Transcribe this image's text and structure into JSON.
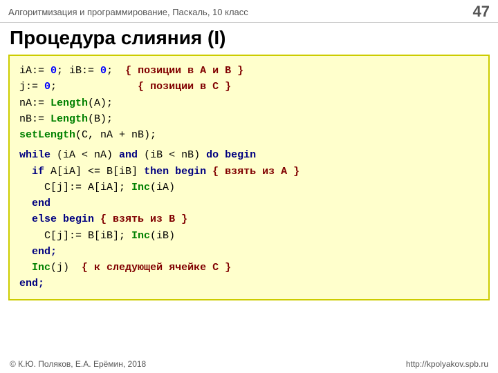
{
  "header": {
    "subtitle": "Алгоритмизация и программирование, Паскаль, 10 класс",
    "page_number": "47"
  },
  "title": "Процедура слияния (I)",
  "footer": {
    "left": "© К.Ю. Поляков, Е.А. Ерёмин, 2018",
    "right": "http://kpolyakov.spb.ru"
  }
}
